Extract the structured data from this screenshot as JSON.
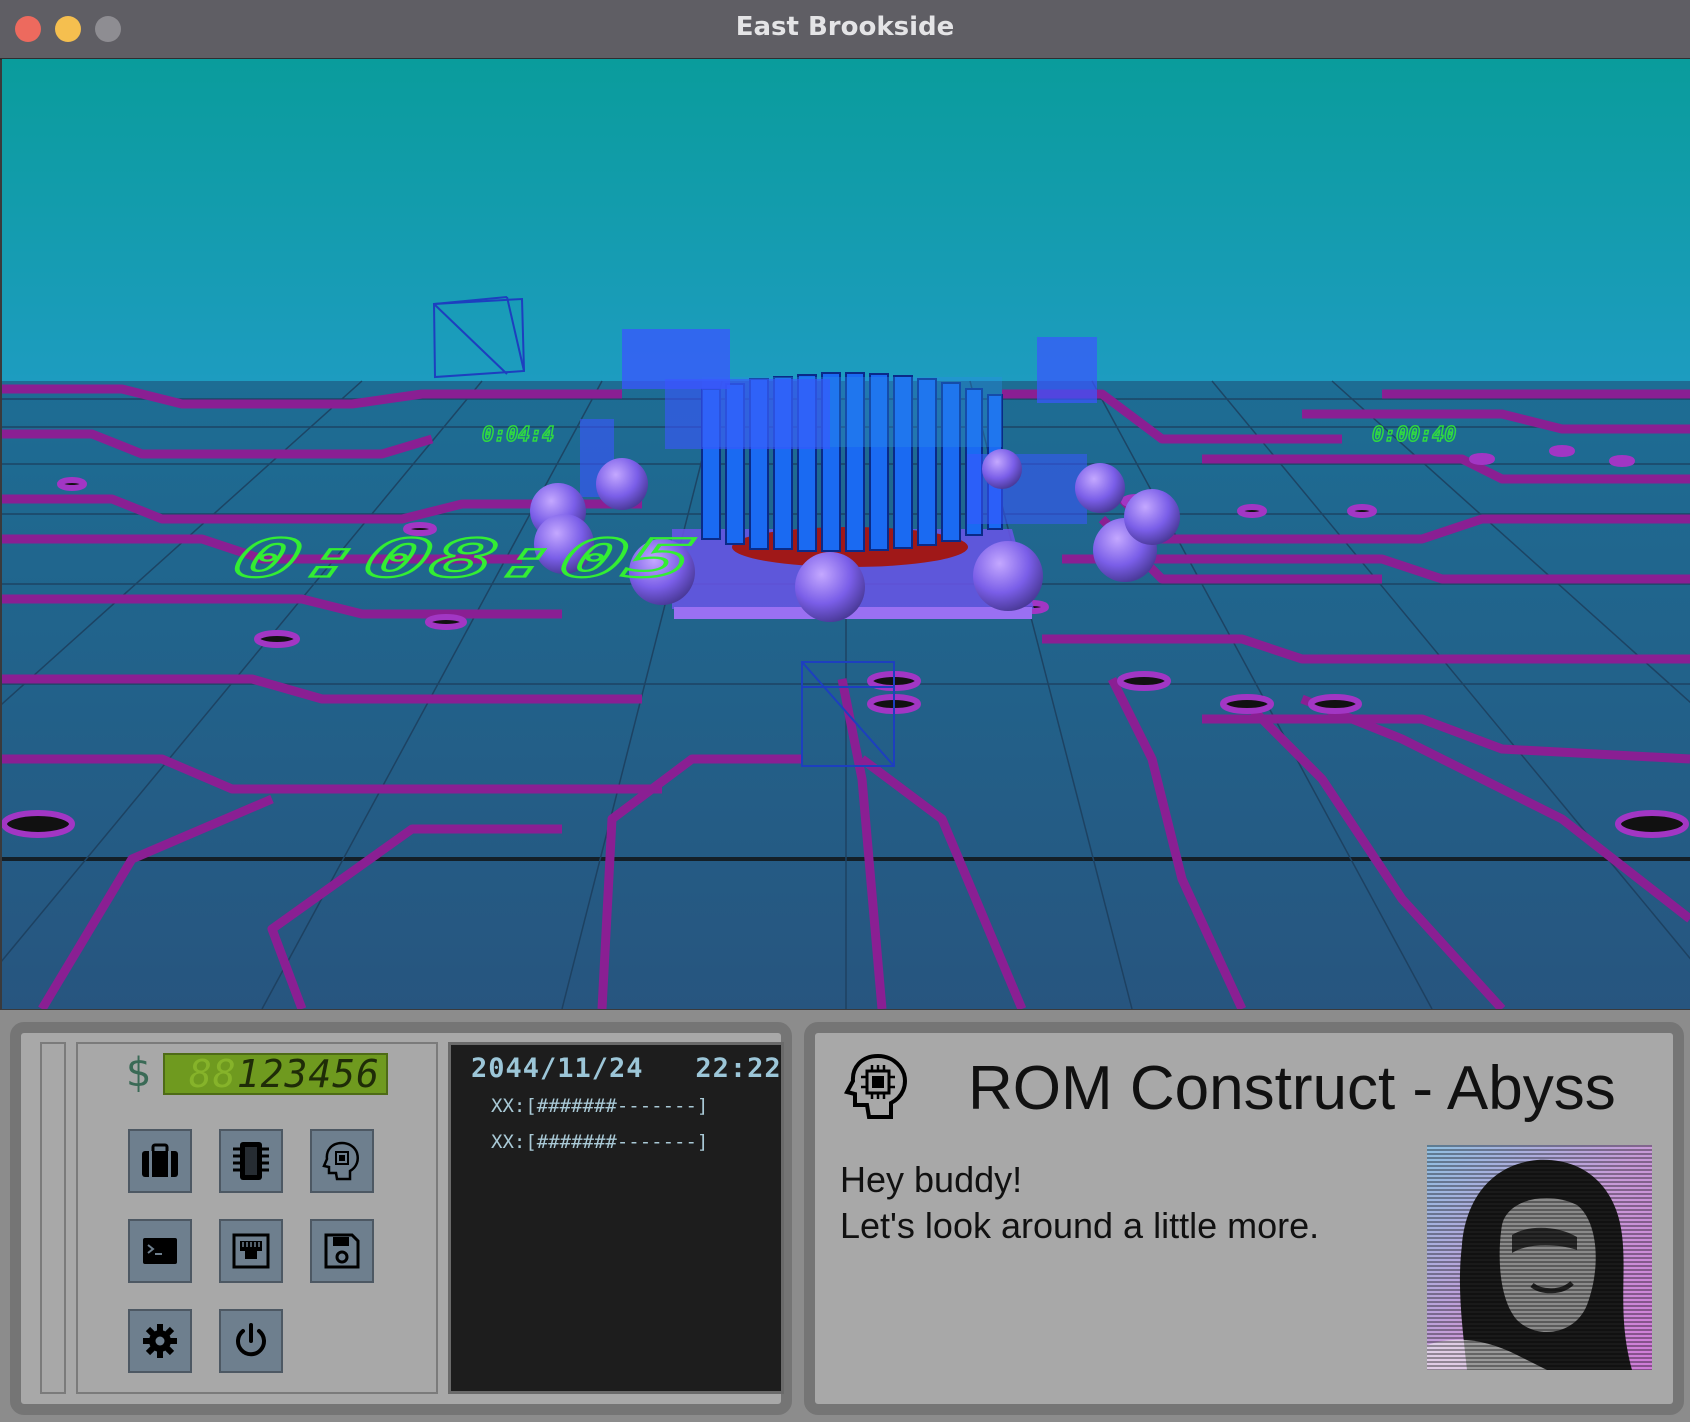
{
  "window": {
    "title": "East Brookside"
  },
  "scene": {
    "floor_text_near": "0:08:05",
    "floor_text_mid": "0:04:4",
    "floor_text_far": "0:00:40"
  },
  "inventory": {
    "currency_symbol": "$",
    "credits_ghost": "88",
    "credits": "123456",
    "buttons": [
      {
        "name": "inventory-button",
        "icon": "briefcase-icon"
      },
      {
        "name": "chip-button",
        "icon": "chip-icon"
      },
      {
        "name": "rom-construct-button",
        "icon": "head-chip-icon"
      },
      {
        "name": "terminal-button",
        "icon": "terminal-icon"
      },
      {
        "name": "network-button",
        "icon": "ethernet-port-icon"
      },
      {
        "name": "save-button",
        "icon": "floppy-disk-icon"
      },
      {
        "name": "settings-button",
        "icon": "gear-icon"
      },
      {
        "name": "power-button",
        "icon": "power-icon"
      }
    ]
  },
  "terminal": {
    "datetime": "2044/11/24   22:22",
    "bars": [
      "XX:[#######-------]",
      "XX:[#######-------]"
    ]
  },
  "construct": {
    "name": "ROM Construct - Abyss",
    "message_line1": "Hey buddy!",
    "message_line2": "Let's look around a little more."
  },
  "colors": {
    "sky_top": "#0a9e9e",
    "sky_bottom": "#1b9cbd",
    "floor": "#235a85",
    "traces": "#8a1f93",
    "hud_text": "#33dd33",
    "heatsink": "#1a66ee",
    "spheres": "#8a6cf0"
  }
}
